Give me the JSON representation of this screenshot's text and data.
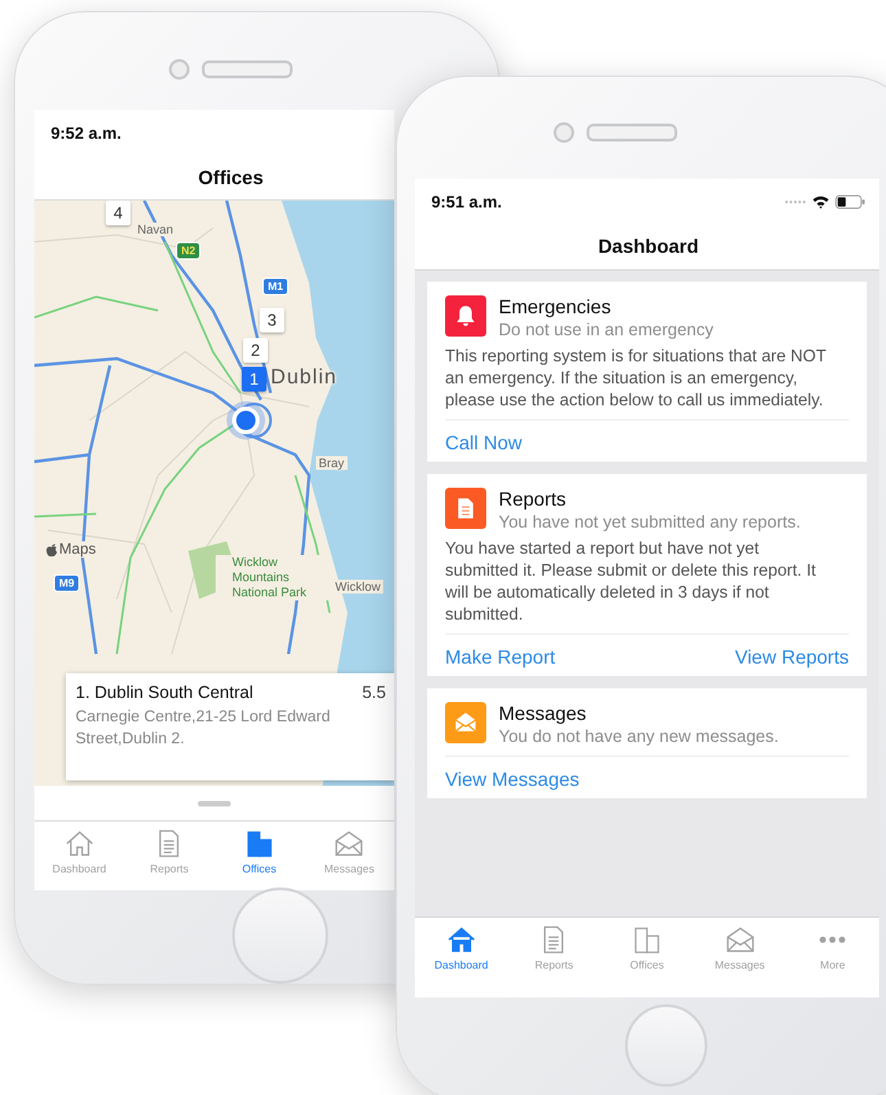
{
  "offices_screen": {
    "status_time": "9:52 a.m.",
    "title": "Offices",
    "map": {
      "pins": [
        {
          "label": "4",
          "selected": false
        },
        {
          "label": "3",
          "selected": false
        },
        {
          "label": "2",
          "selected": false
        },
        {
          "label": "1",
          "selected": true
        }
      ],
      "places": [
        "Navan",
        "Dublin",
        "Bray",
        "Wicklow Mountains National Park",
        "Wicklow"
      ],
      "shields": [
        "N2",
        "M1",
        "M9"
      ],
      "attribution": "Maps"
    },
    "office_card": {
      "title": "1. Dublin South Central",
      "distance": "5.5",
      "address": "Carnegie Centre,21-25 Lord Edward Street,Dublin 2."
    },
    "tabs": [
      {
        "label": "Dashboard",
        "selected": false
      },
      {
        "label": "Reports",
        "selected": false
      },
      {
        "label": "Offices",
        "selected": true
      },
      {
        "label": "Messages",
        "selected": false
      }
    ]
  },
  "dashboard_screen": {
    "status_time": "9:51 a.m.",
    "title": "Dashboard",
    "cards": [
      {
        "kind": "emergency",
        "color": "#f4223d",
        "title": "Emergencies",
        "subtitle": "Do not use in an emergency",
        "body": "This reporting system is for situations that are NOT an emergency. If the situation is an emergency, please use the action below to call us immediately.",
        "actions": [
          "Call Now"
        ]
      },
      {
        "kind": "reports",
        "color": "#fb5a25",
        "title": "Reports",
        "subtitle": "You have not yet submitted any reports.",
        "body": "You have started a report but have not yet submitted it. Please submit or delete this report. It will be automatically deleted in 3 days if not submitted.",
        "actions": [
          "Make Report",
          "View Reports"
        ]
      },
      {
        "kind": "messages",
        "color": "#fd9a16",
        "title": "Messages",
        "subtitle": "You do not have any new messages.",
        "actions": [
          "View Messages"
        ]
      }
    ],
    "tabs": [
      {
        "label": "Dashboard",
        "selected": true
      },
      {
        "label": "Reports",
        "selected": false
      },
      {
        "label": "Offices",
        "selected": false
      },
      {
        "label": "Messages",
        "selected": false
      },
      {
        "label": "More",
        "selected": false
      }
    ]
  }
}
